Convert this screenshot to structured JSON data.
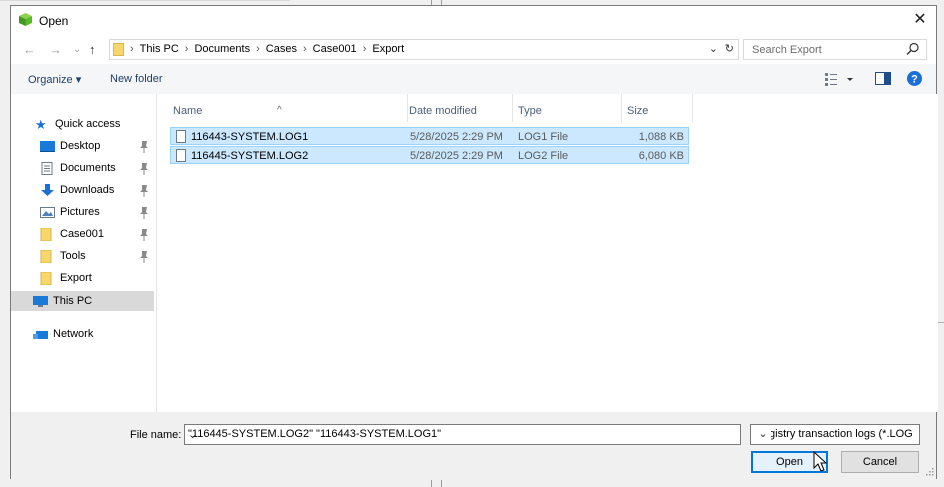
{
  "window": {
    "title": "Open",
    "close": "✕"
  },
  "address": {
    "crumbs": [
      "This PC",
      "Documents",
      "Cases",
      "Case001",
      "Export"
    ],
    "separator": "›"
  },
  "search": {
    "placeholder": "Search Export"
  },
  "toolbar": {
    "organize": "Organize ▾",
    "new_folder": "New folder"
  },
  "nav": {
    "quick_access": "Quick access",
    "items": [
      "Desktop",
      "Documents",
      "Downloads",
      "Pictures",
      "Case001",
      "Tools",
      "Export"
    ],
    "this_pc": "This PC",
    "network": "Network"
  },
  "columns": {
    "name": "Name",
    "date": "Date modified",
    "type": "Type",
    "size": "Size"
  },
  "files": [
    {
      "name": "116443-SYSTEM.LOG1",
      "date": "5/28/2025 2:29 PM",
      "type": "LOG1 File",
      "size": "1,088 KB"
    },
    {
      "name": "116445-SYSTEM.LOG2",
      "date": "5/28/2025 2:29 PM",
      "type": "LOG2 File",
      "size": "6,080 KB"
    }
  ],
  "bottom": {
    "file_name_label": "File name:",
    "file_name_value": "\"116445-SYSTEM.LOG2\" \"116443-SYSTEM.LOG1\"",
    "filter": "Registry transaction logs (*.LOG",
    "open": "Open",
    "cancel": "Cancel"
  },
  "colors": {
    "accent": "#0078d7",
    "selection": "#cce8ff",
    "folder": "#f7d76b"
  }
}
